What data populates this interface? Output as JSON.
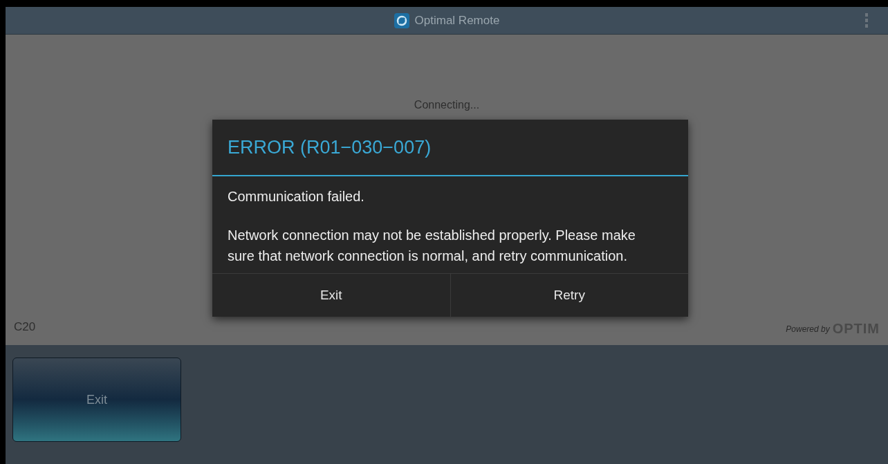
{
  "header": {
    "title": "Optimal Remote"
  },
  "content": {
    "status": "Connecting...",
    "code": "C20",
    "powered_by": "Powered by",
    "brand": "OPTIM"
  },
  "bottom_bar": {
    "buttons": [
      "Exit"
    ]
  },
  "dialog": {
    "title": "ERROR (R01−030−007)",
    "messages": [
      "Communication failed.",
      "Network connection may not be established properly. Please make sure that network connection is normal, and retry communication."
    ],
    "buttons": [
      "Exit",
      "Retry"
    ]
  }
}
